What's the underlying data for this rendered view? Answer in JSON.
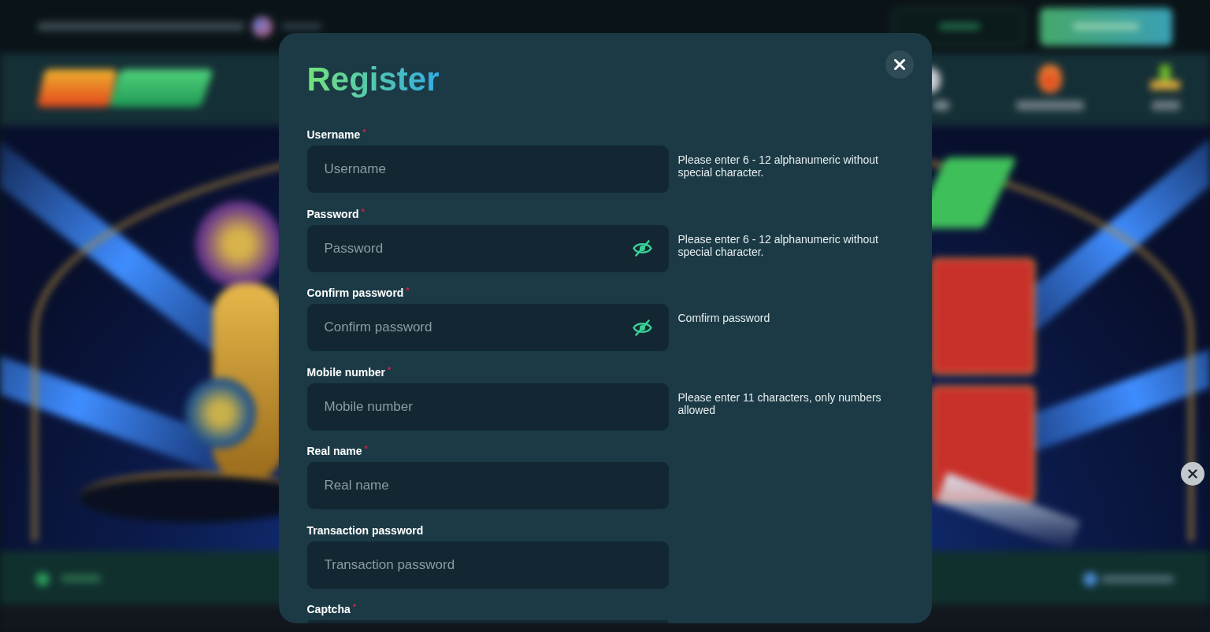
{
  "dialog": {
    "title": "Register",
    "fields": [
      {
        "label": "Username",
        "required_mark": "*",
        "kind": "text",
        "placeholder": "Username",
        "hint": "Please enter 6 - 12 alphanumeric without special character."
      },
      {
        "label": "Password",
        "required_mark": "*",
        "kind": "password",
        "masked": true,
        "placeholder": "Password",
        "hint": "Please enter 6 - 12 alphanumeric without special character."
      },
      {
        "label": "Confirm password",
        "required_mark": "*",
        "kind": "password",
        "masked": true,
        "placeholder": "Confirm password",
        "hint": "Comfirm password"
      },
      {
        "label": "Mobile number",
        "required_mark": "*",
        "kind": "text",
        "placeholder": "Mobile number",
        "hint": "Please enter 11 characters, only numbers allowed"
      },
      {
        "label": "Real name",
        "required_mark": "*",
        "kind": "text",
        "placeholder": "Real name"
      },
      {
        "label": "Transaction password",
        "kind": "text",
        "placeholder": "Transaction password"
      },
      {
        "label": "Captcha",
        "required_mark": "*",
        "kind": "text"
      }
    ]
  }
}
